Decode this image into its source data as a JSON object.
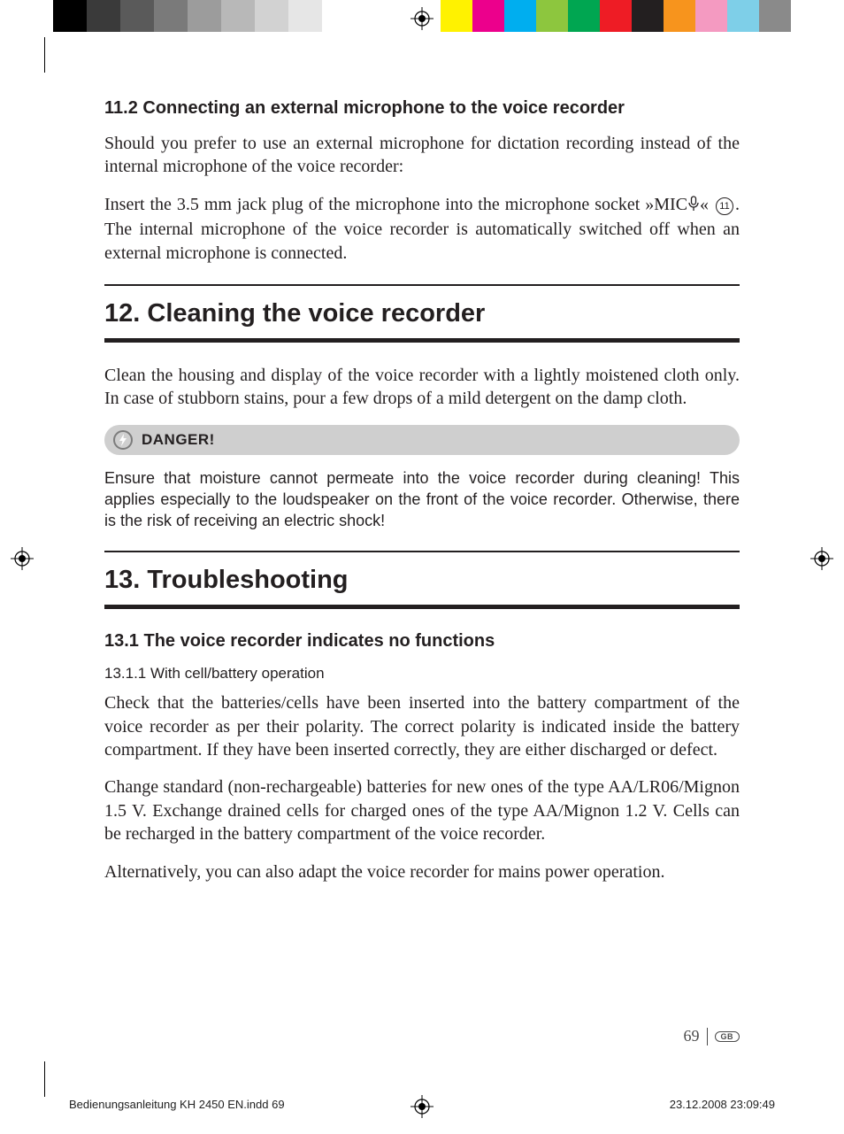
{
  "colorbars": {
    "left": [
      "#000000",
      "#3a3a3a",
      "#5a5a5a",
      "#7a7a7a",
      "#9c9c9c",
      "#b8b8b8",
      "#d2d2d2",
      "#e6e6e6",
      "#ffffff"
    ],
    "right": [
      "#fff200",
      "#ec008c",
      "#00aeef",
      "#8dc63e",
      "#00a651",
      "#ee1c25",
      "#231f20",
      "#f7941d",
      "#f49ac1",
      "#7ecfe8",
      "#8a8a8a"
    ]
  },
  "section_11_2": {
    "heading": "11.2 Connecting an external microphone to the voice recorder",
    "p1": "Should you prefer to use an external microphone for dictation recording instead of the internal microphone of the voice recorder:",
    "p2_a": "Insert the 3.5 mm jack plug of the microphone into the microphone socket »MIC",
    "p2_b": "« ",
    "p2_refnum": "11",
    "p2_c": ". The internal microphone of the voice recorder is automatically switched off when an external microphone is connected."
  },
  "section_12": {
    "heading": "12. Cleaning the voice recorder",
    "p1": "Clean the housing and display of the voice recorder with a lightly moistened cloth only. In case of stubborn stains, pour a few drops of a mild detergent on the damp cloth.",
    "danger_label": "DANGER!",
    "danger_text": "Ensure that moisture cannot permeate into the voice recorder during cleaning! This applies especially to the loudspeaker on the front of the voice recorder. Otherwise, there is the risk of receiving an electric shock!"
  },
  "section_13": {
    "heading": "13. Troubleshooting",
    "sub_13_1": "13.1 The voice recorder indicates no functions",
    "sub_13_1_1": "13.1.1 With cell/battery operation",
    "p1": "Check that the batteries/cells have been inserted into the battery compartment of the voice recorder as per their polarity. The correct polarity is indicated inside the battery compartment. If they have been inserted correctly, they are either discharged or defect.",
    "p2": "Change standard (non-rechargeable) batteries for new ones of the type AA/LR06/Mignon 1.5 V. Exchange drained cells for charged ones of the type AA/Mignon 1.2 V. Cells can be recharged in the battery compartment of the voice recorder.",
    "p3": "Alternatively, you can also adapt the voice recorder for mains power operation."
  },
  "footer": {
    "page_number": "69",
    "lang": "GB",
    "slug_left": "Bedienungsanleitung KH 2450 EN.indd   69",
    "slug_right": "23.12.2008   23:09:49"
  }
}
